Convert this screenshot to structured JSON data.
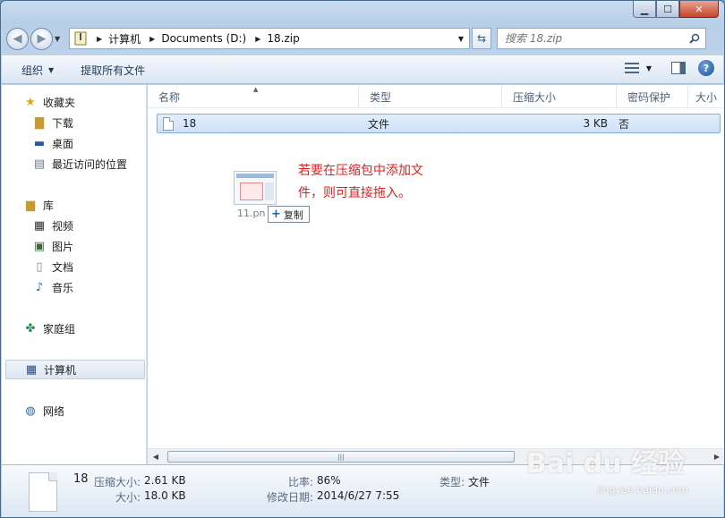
{
  "address": {
    "crumbs": [
      "计算机",
      "Documents (D:)",
      "18.zip"
    ],
    "search_placeholder": "搜索 18.zip"
  },
  "toolbar": {
    "organize_label": "组织",
    "extract_label": "提取所有文件"
  },
  "nav": {
    "favorites": "收藏夹",
    "downloads": "下载",
    "desktop": "桌面",
    "recent": "最近访问的位置",
    "libraries": "库",
    "videos": "视频",
    "pictures": "图片",
    "documents": "文档",
    "music": "音乐",
    "homegroup": "家庭组",
    "computer": "计算机",
    "network": "网络"
  },
  "columns": [
    "名称",
    "类型",
    "压缩大小",
    "密码保护",
    "大小"
  ],
  "files": [
    {
      "name": "18",
      "type": "文件",
      "compressed": "3 KB",
      "password": "否"
    }
  ],
  "annotation": "若要在压缩包中添加文件，则可直接拖入。",
  "drag": {
    "filename": "11.pn",
    "tooltip": "复制"
  },
  "details": {
    "name": "18",
    "compressed_key": "压缩大小:",
    "compressed_val": "2.61 KB",
    "size_key": "大小:",
    "size_val": "18.0 KB",
    "ratio_key": "比率:",
    "ratio_val": "86%",
    "modified_key": "修改日期:",
    "modified_val": "2014/6/27 7:55",
    "type_key": "类型:",
    "type_val": "文件"
  },
  "watermark": {
    "brand": "Bai du 经验",
    "url": "jingyan.baidu.com"
  },
  "colors": {
    "annotation": "#e02020",
    "selection": "#cde2f8"
  }
}
